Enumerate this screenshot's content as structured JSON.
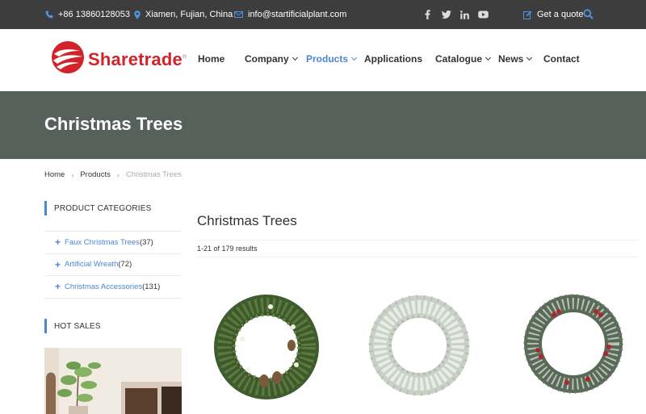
{
  "topbar": {
    "phone": "+86 13860128053",
    "location": "Xiamen, Fujian, China",
    "email": "info@startificialplant.com",
    "social": [
      "facebook-icon",
      "twitter-icon",
      "linkedin-icon",
      "youtube-icon"
    ],
    "quote_label": "Get a quote"
  },
  "brand": {
    "name": "Sharetrade",
    "reg": "®",
    "color": "#d3232a"
  },
  "nav": {
    "items": [
      {
        "label": "Home",
        "dropdown": false
      },
      {
        "label": "Company",
        "dropdown": true
      },
      {
        "label": "Products",
        "dropdown": true,
        "active": true
      },
      {
        "label": "Applications",
        "dropdown": false
      },
      {
        "label": "Catalogue",
        "dropdown": true
      },
      {
        "label": "News",
        "dropdown": true
      },
      {
        "label": "Contact",
        "dropdown": false
      }
    ],
    "active_color": "#4a86d6"
  },
  "banner": {
    "title": "Christmas Trees",
    "bg_color": "#56615b"
  },
  "breadcrumb": {
    "home": "Home",
    "products": "Products",
    "current": "Christmas Trees"
  },
  "sidebar": {
    "categories_heading": "PRODUCT CATEGORIES",
    "categories": [
      {
        "label": "Faux Christmas Trees",
        "count": "(37)"
      },
      {
        "label": "Artificial Wreath",
        "count": "(72)"
      },
      {
        "label": "Christmas Accessories",
        "count": "(131)"
      }
    ],
    "hot_heading": "HOT SALES"
  },
  "main": {
    "title": "Christmas Trees",
    "results": "1-21 of 179 results"
  }
}
